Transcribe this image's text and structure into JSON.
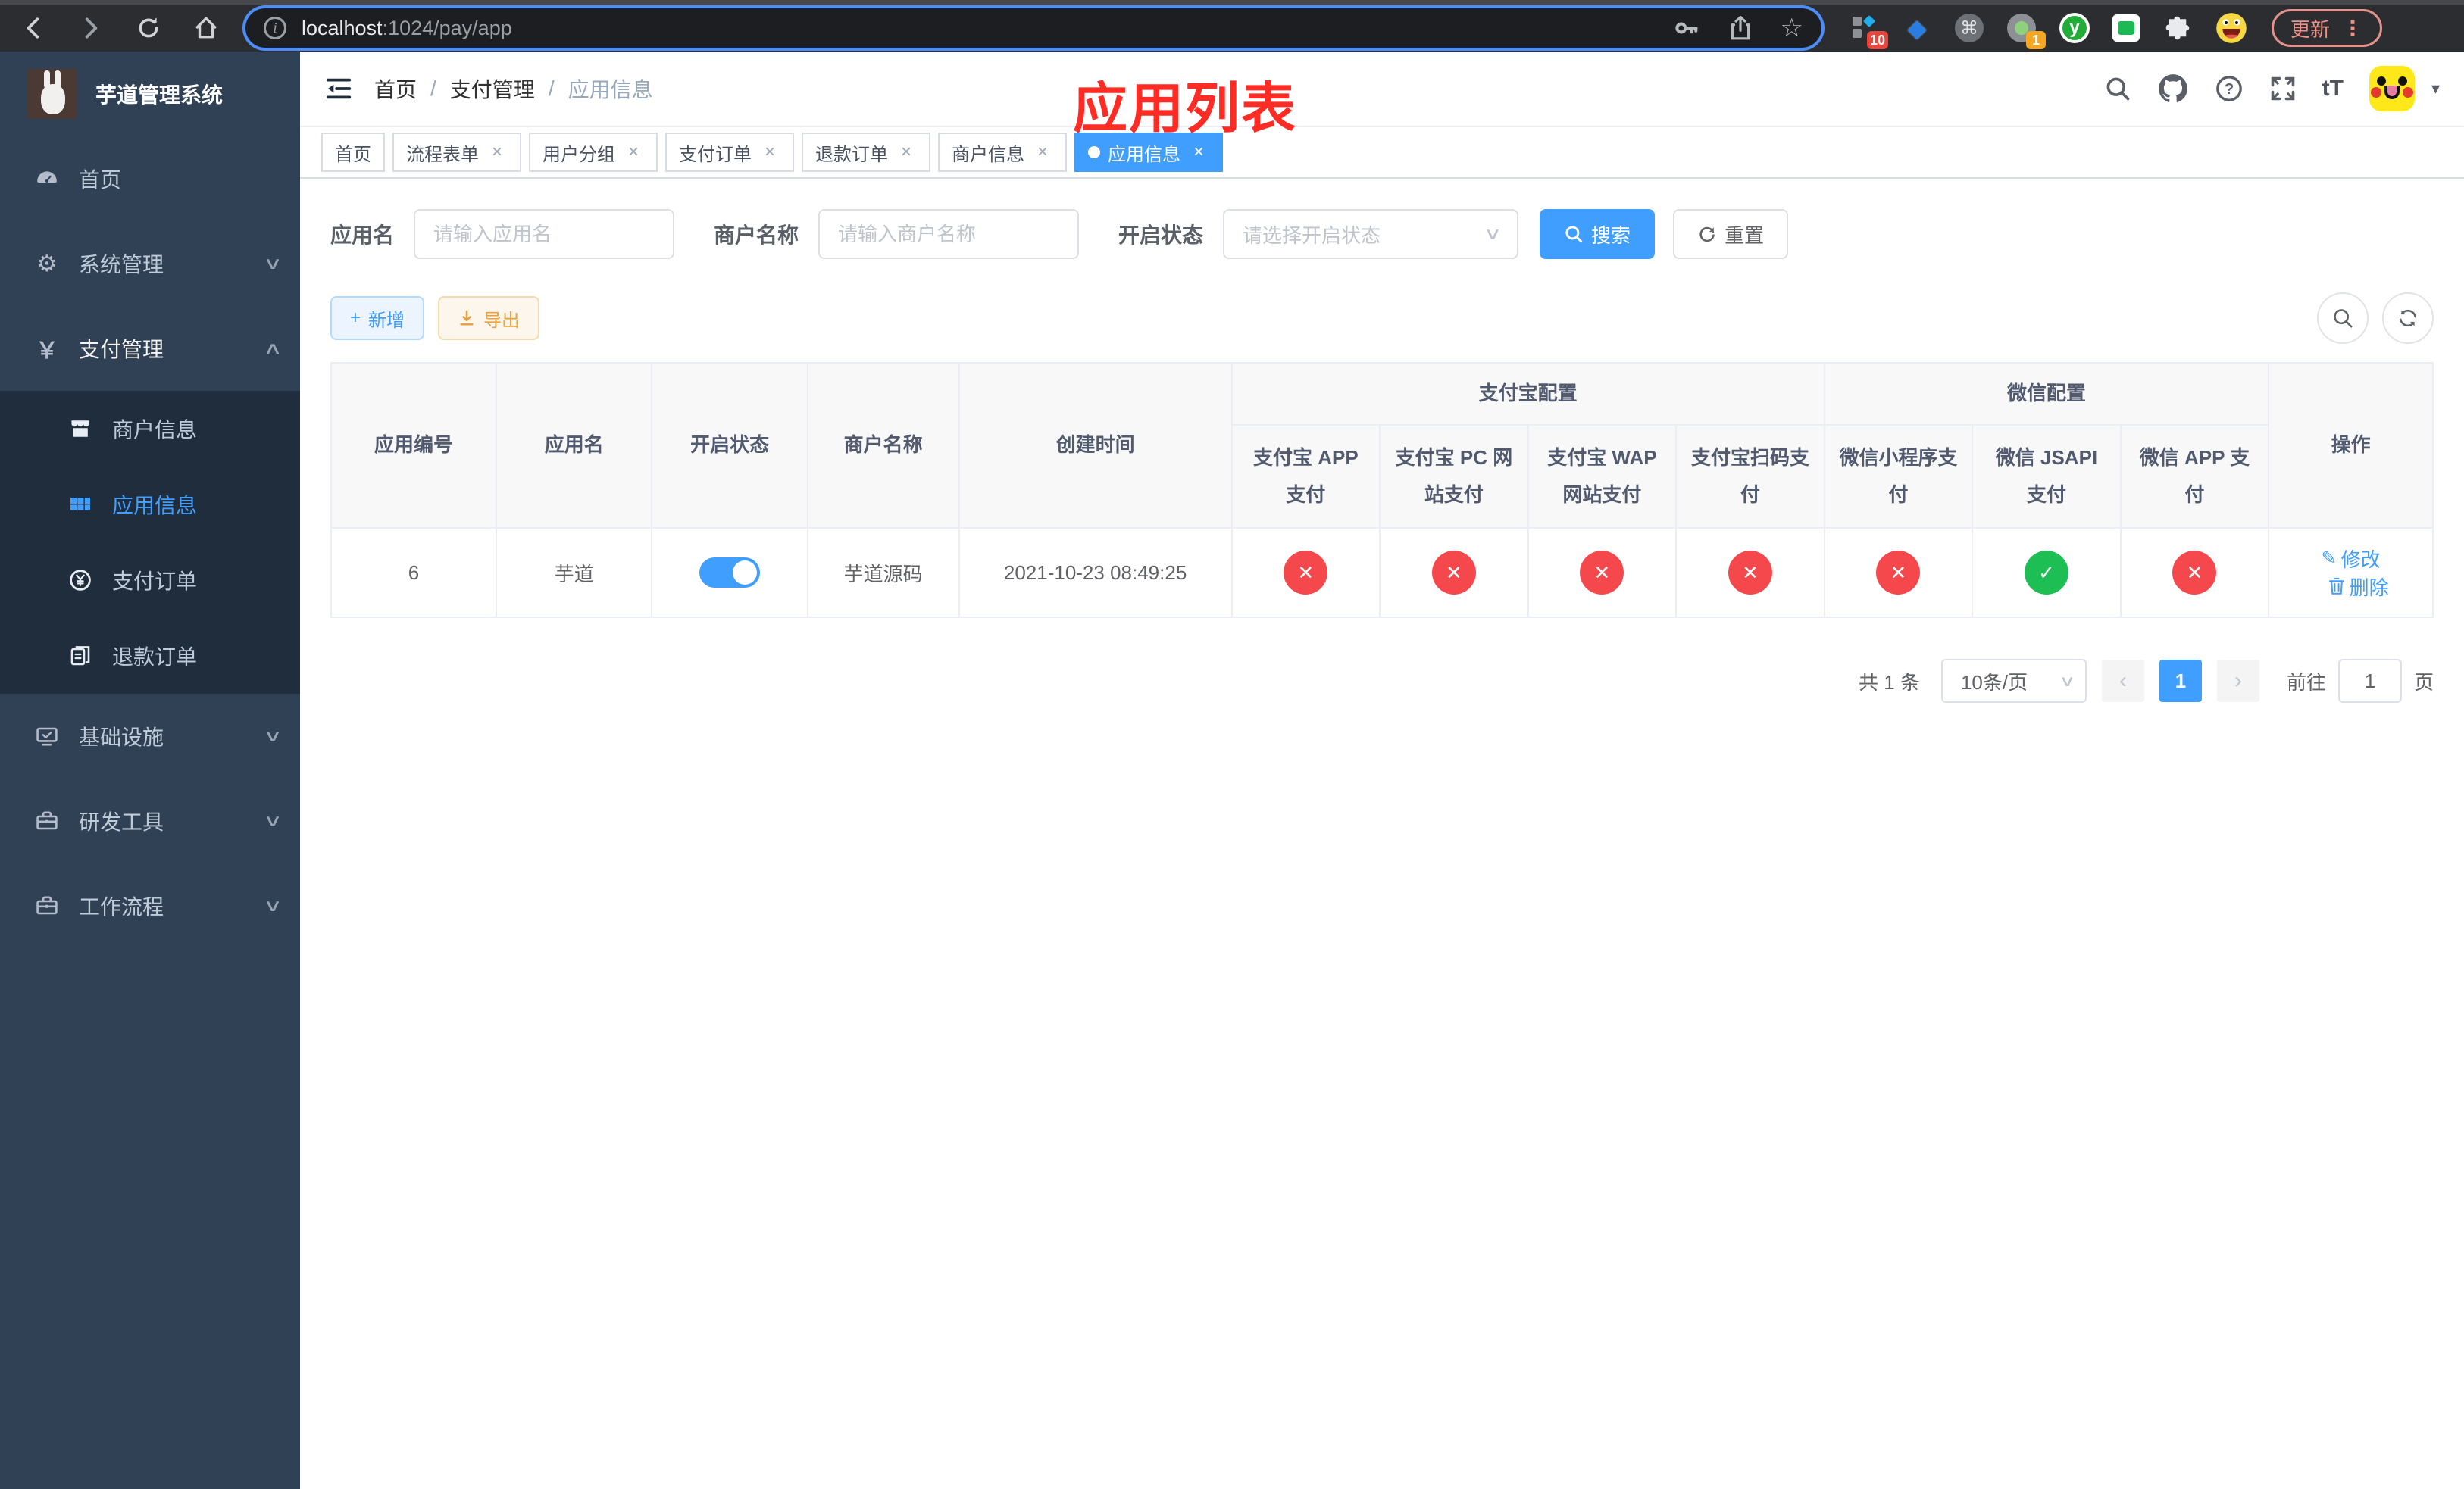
{
  "browser": {
    "url": {
      "host": "localhost",
      "path": ":1024/pay/app"
    },
    "update_label": "更新",
    "ext_badge_10": "10",
    "ext_badge_1": "1",
    "ext_y_label": "y"
  },
  "sidebar": {
    "logo_title": "芋道管理系统",
    "items": [
      {
        "label": "首页"
      },
      {
        "label": "系统管理"
      },
      {
        "label": "支付管理"
      },
      {
        "label": "基础设施"
      },
      {
        "label": "研发工具"
      },
      {
        "label": "工作流程"
      }
    ],
    "submenu": [
      {
        "label": "商户信息"
      },
      {
        "label": "应用信息"
      },
      {
        "label": "支付订单"
      },
      {
        "label": "退款订单"
      }
    ]
  },
  "navbar": {
    "breadcrumb": [
      "首页",
      "支付管理",
      "应用信息"
    ],
    "annotation": "应用列表"
  },
  "tabs": [
    {
      "label": "首页"
    },
    {
      "label": "流程表单"
    },
    {
      "label": "用户分组"
    },
    {
      "label": "支付订单"
    },
    {
      "label": "退款订单"
    },
    {
      "label": "商户信息"
    },
    {
      "label": "应用信息"
    }
  ],
  "filters": {
    "app_name_label": "应用名",
    "app_name_placeholder": "请输入应用名",
    "merchant_label": "商户名称",
    "merchant_placeholder": "请输入商户名称",
    "status_label": "开启状态",
    "status_placeholder": "请选择开启状态",
    "search_label": "搜索",
    "reset_label": "重置"
  },
  "toolbar": {
    "add_label": "新增",
    "export_label": "导出"
  },
  "table": {
    "headers": {
      "app_id": "应用编号",
      "app_name": "应用名",
      "status": "开启状态",
      "merchant": "商户名称",
      "created": "创建时间",
      "action": "操作"
    },
    "groups": {
      "alipay": "支付宝配置",
      "wechat": "微信配置"
    },
    "sub_headers": [
      "支付宝 APP 支付",
      "支付宝 PC 网站支付",
      "支付宝 WAP 网站支付",
      "支付宝扫码支付",
      "微信小程序支付",
      "微信 JSAPI 支付",
      "微信 APP 支付"
    ],
    "rows": [
      {
        "app_id": "6",
        "app_name": "芋道",
        "enabled": true,
        "merchant": "芋道源码",
        "created": "2021-10-23 08:49:25",
        "channels": [
          "fail",
          "fail",
          "fail",
          "fail",
          "fail",
          "pass",
          "fail"
        ],
        "edit_label": "修改",
        "delete_label": "删除"
      }
    ]
  },
  "pagination": {
    "total": "共 1 条",
    "page_size": "10条/页",
    "page": "1",
    "goto_prefix": "前往",
    "goto_value": "1",
    "goto_suffix": "页"
  },
  "icons": {
    "pass_glyph": "✓",
    "fail_glyph": "✕",
    "close_glyph": "×",
    "breadcrumb_sep": "/",
    "chevron_down": "∨",
    "chevron_up": "∧",
    "caret_down": "▾",
    "prev": "‹",
    "next": "›",
    "font_size": "tT",
    "command": "⌘",
    "star": "☆",
    "more": "⋮",
    "plus": "+",
    "question": "?",
    "info": "i",
    "yen": "￥"
  },
  "colors": {
    "accent": "#409EFF",
    "success": "#1DBE53",
    "danger": "#F5484D",
    "warning": "#E6A23C",
    "annotation_red": "#FE2C24",
    "sidebar_bg": "#304156",
    "submenu_bg": "#1F2D3D"
  }
}
